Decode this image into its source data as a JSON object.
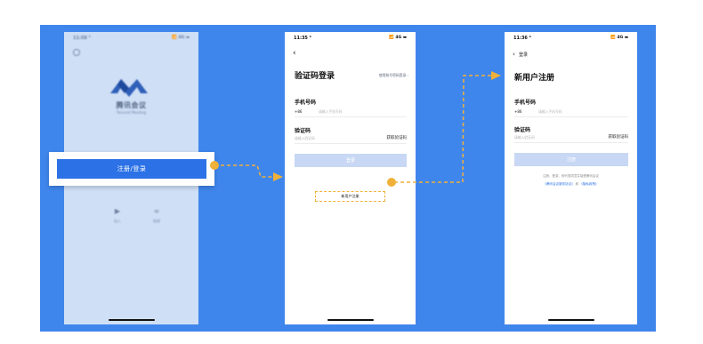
{
  "colors": {
    "canvas": "#3f86ec",
    "accent": "#2c72e6",
    "flow": "#f0b13a"
  },
  "screen1": {
    "time": "11:58 ⁴",
    "signal": "📶 4G ▬",
    "logo_icon": "tencent-meeting-logo",
    "app_name": "腾讯会议",
    "app_sub": "Tencent Meeting",
    "register_login": "注册/登录",
    "join_caption": "加入",
    "link_caption": "链接"
  },
  "screen2": {
    "time": "11:35 ⁴",
    "signal": "📶 4G ▬",
    "back": "‹",
    "title": "验证码登录",
    "switch_link": "使用账号密码登录 ›",
    "phone_label": "手机号码",
    "country_code": "+86",
    "phone_placeholder": "请输入手机号码",
    "code_label": "验证码",
    "code_placeholder": "请输入验证码",
    "get_code": "获取验证码",
    "login_button": "登录",
    "new_user": "新用户注册"
  },
  "screen3": {
    "time": "11:36 ⁴",
    "signal": "📶 4G ▬",
    "back": "‹",
    "back_label": "登录",
    "title": "新用户注册",
    "phone_label": "手机号码",
    "country_code": "+86",
    "phone_placeholder": "请输入手机号码",
    "code_label": "验证码",
    "code_placeholder": "请输入验证码",
    "get_code": "获取验证码",
    "register_button": "注册",
    "agree_text": "注册、登录、即代表同意并接受腾讯会议",
    "terms_link": "《腾讯会议服务协议》",
    "and_text": "和",
    "privacy_link": "《隐私政策》"
  }
}
